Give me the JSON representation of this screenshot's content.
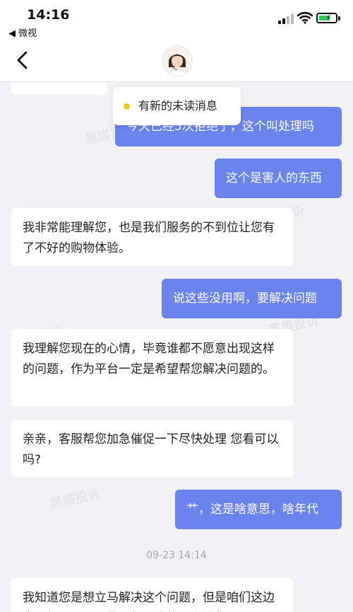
{
  "status_bar": {
    "time": "14:16",
    "back_app": "◀ 微视"
  },
  "unread_notice": {
    "text": "有新的未读消息"
  },
  "messages": [
    {
      "text": "今天已经5次拒绝了，这个叫处理吗"
    },
    {
      "text": "这个是害人的东西"
    },
    {
      "text": "我非常能理解您，也是我们服务的不到位让您有了不好的购物体验。"
    },
    {
      "text": "说这些没用啊，要解决问题"
    },
    {
      "text": "我理解您现在的心情，毕竟谁都不愿意出现这样的问题，作为平台一定是希望帮您解决问题的。"
    },
    {
      "text": "亲亲，客服帮您加急催促一下尽快处理 您看可以吗?"
    },
    {
      "text": "艹，这是啥意思，啥年代"
    },
    {
      "text": "我知道您是想立马解决这个问题，但是咱们这边客服权限是不同的，如果我能马上给您"
    }
  ],
  "timestamp": "09-23 14:14",
  "watermark": "黑猫投诉"
}
